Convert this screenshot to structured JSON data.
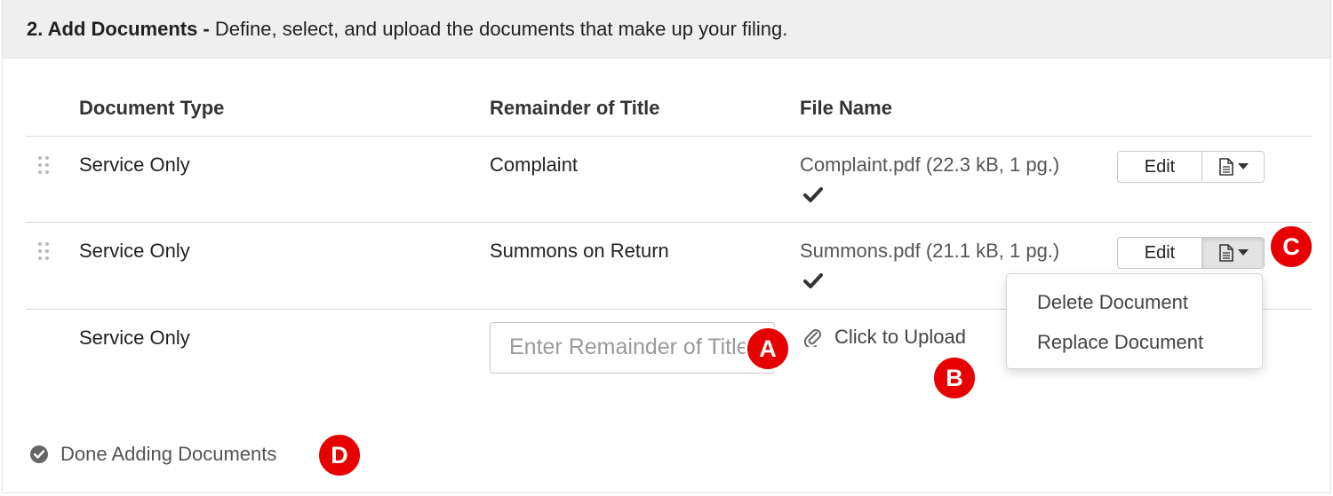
{
  "section": {
    "number_title": "2. Add Documents -",
    "description": " Define, select, and upload the documents that make up your filing."
  },
  "columns": {
    "document_type": "Document Type",
    "remainder_of_title": "Remainder of Title",
    "file_name": "File Name"
  },
  "rows": [
    {
      "document_type": "Service Only",
      "remainder_of_title": "Complaint",
      "file_name": "Complaint.pdf (22.3 kB, 1 pg.)",
      "edit_label": "Edit",
      "status_icon": "checkmark-icon"
    },
    {
      "document_type": "Service Only",
      "remainder_of_title": "Summons on Return",
      "file_name": "Summons.pdf (21.1 kB, 1 pg.)",
      "edit_label": "Edit",
      "status_icon": "checkmark-icon"
    },
    {
      "document_type": "Service Only",
      "remainder_placeholder": "Enter Remainder of Title",
      "upload_label": "Click to Upload"
    }
  ],
  "document_menu": {
    "items": [
      "Delete Document",
      "Replace Document"
    ]
  },
  "done_label": "Done Adding Documents",
  "markers": [
    "A",
    "B",
    "C",
    "D"
  ],
  "colors": {
    "marker": "#e60000",
    "header_bg": "#efefef"
  }
}
